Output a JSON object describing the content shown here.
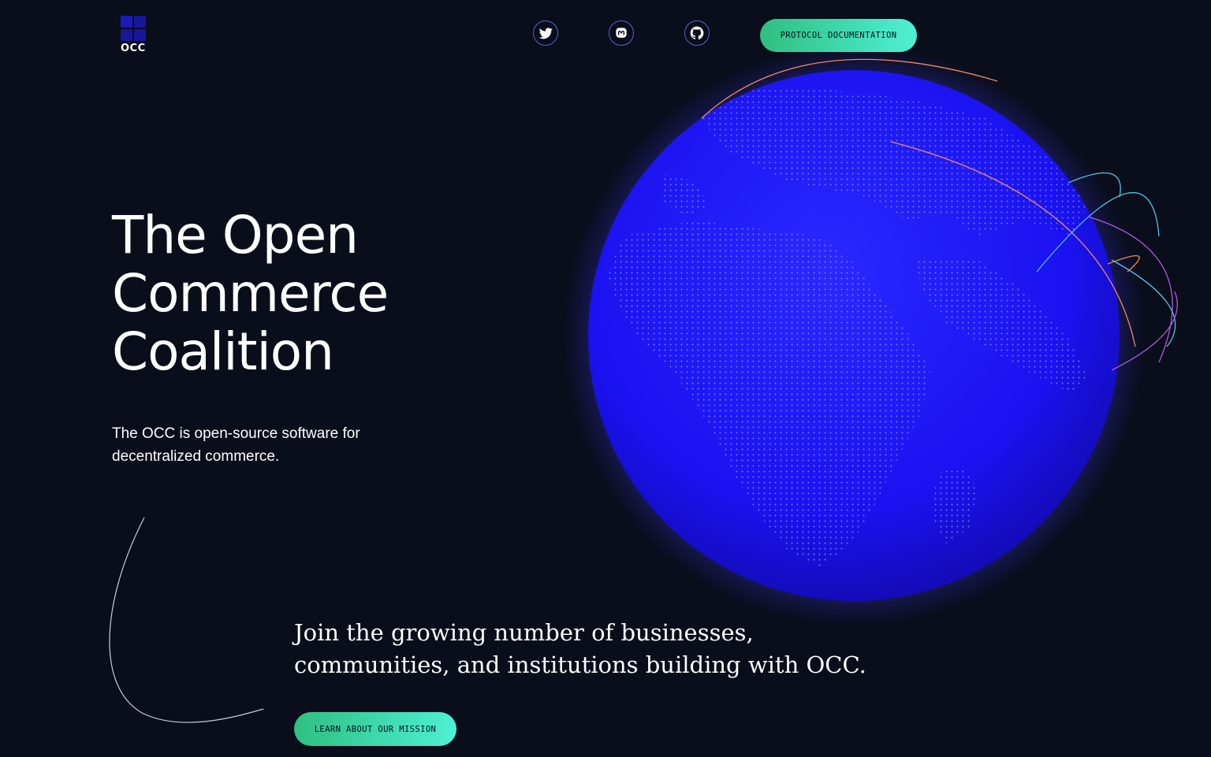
{
  "brand": {
    "logo_text": "OCC"
  },
  "nav": {
    "doc_button": "PROTOCOL DOCUMENTATION"
  },
  "hero": {
    "title_lines": [
      "The Open",
      "Commerce",
      "Coalition"
    ],
    "subtitle": "The OCC is open-source software for decentralized commerce."
  },
  "join": {
    "lines": [
      "Join the growing number of businesses,",
      "communities, and institutions building with OCC."
    ],
    "button": "LEARN ABOUT OUR MISSION"
  },
  "colors": {
    "background": "#0a0d1a",
    "globe": "#1a14f5",
    "button_start": "#2fbf80",
    "button_end": "#4ef0d6"
  },
  "icons": [
    "twitter-icon",
    "mastodon-icon",
    "github-icon"
  ]
}
